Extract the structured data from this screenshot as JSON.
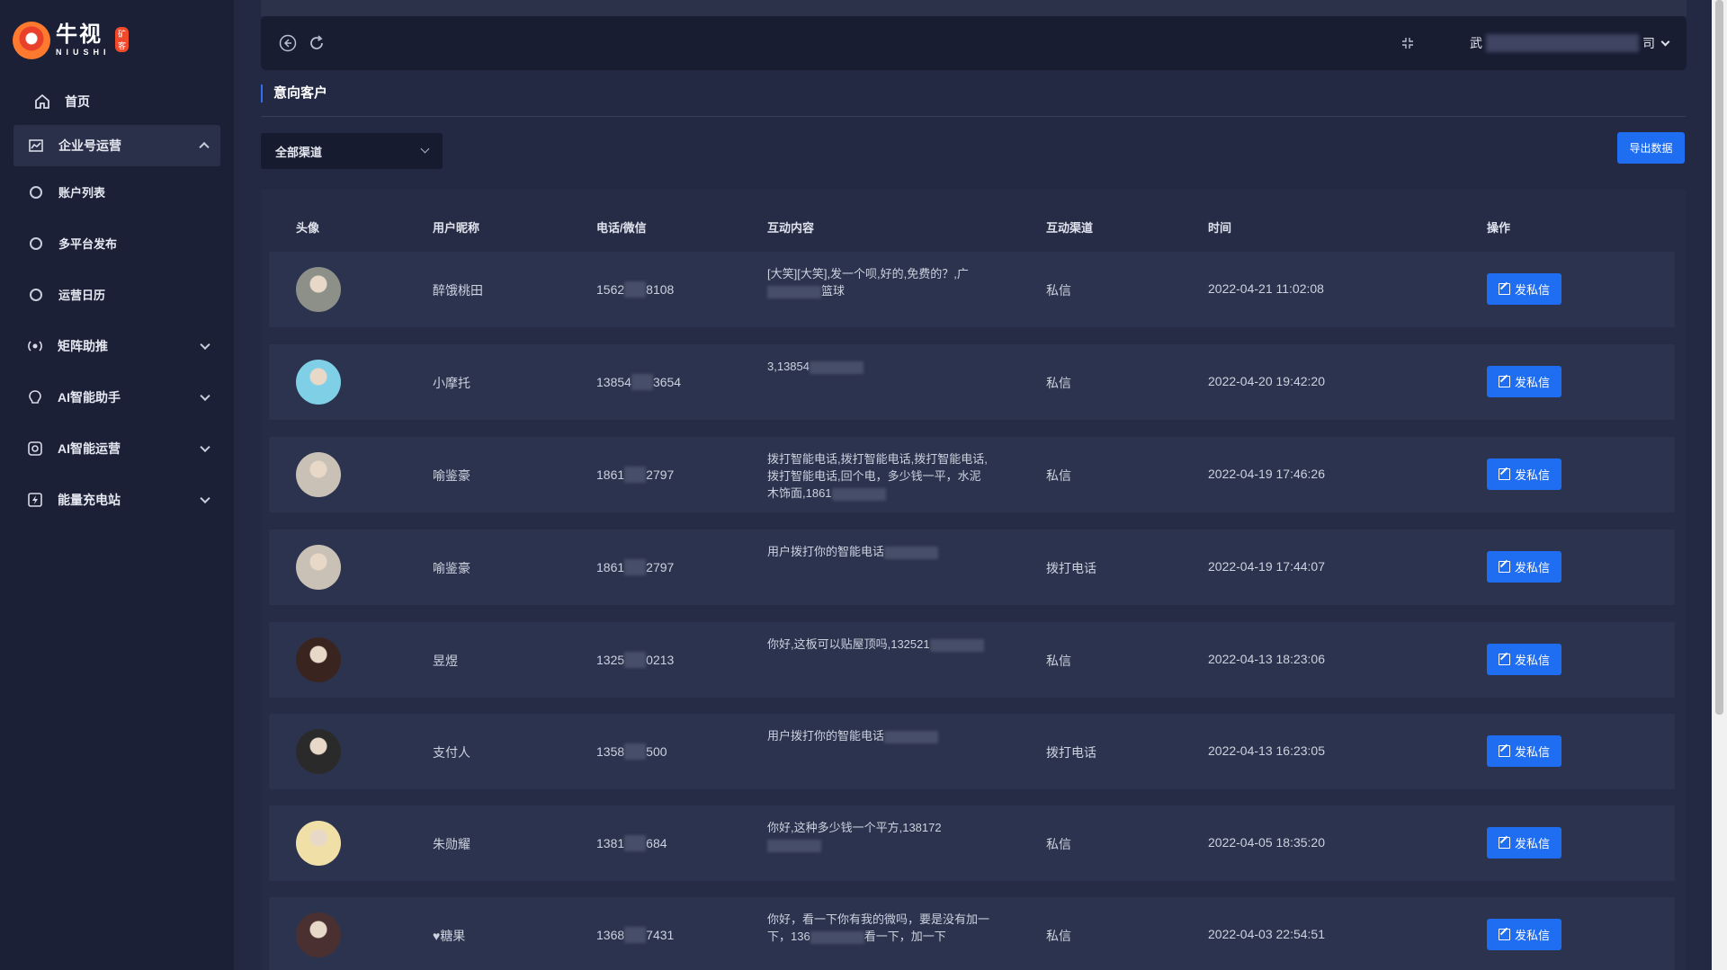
{
  "brand": {
    "name_cn": "牛视",
    "name_en": "NIUSHI",
    "badge": "矿客"
  },
  "sidebar": {
    "home": "首页",
    "group": {
      "label": "企业号运营",
      "items": [
        {
          "label": "账户列表"
        },
        {
          "label": "多平台发布"
        },
        {
          "label": "运营日历"
        }
      ]
    },
    "items": [
      {
        "label": "矩阵助推"
      },
      {
        "label": "AI智能助手"
      },
      {
        "label": "AI智能运营"
      },
      {
        "label": "能量充电站"
      }
    ]
  },
  "topbar": {
    "user_prefix": "武",
    "user_suffix": "司"
  },
  "page": {
    "title": "意向客户",
    "filter_selected": "全部渠道",
    "export_label": "导出数据"
  },
  "table": {
    "headers": [
      "头像",
      "用户昵称",
      "电话/微信",
      "互动内容",
      "互动渠道",
      "时间",
      "操作"
    ],
    "action_label": "发私信",
    "rows": [
      {
        "nickname": "醉饿桃田",
        "phone_a": "1562",
        "phone_b": "8108",
        "content": "[大笑][大笑],发一个呗,好的,免费的？,广",
        "content2": "篮球",
        "channel": "私信",
        "time": "2022-04-21 11:02:08",
        "avatar_color": "#8c9088"
      },
      {
        "nickname": "小摩托",
        "phone_a": "13854",
        "phone_b": "3654",
        "content": "3,13854",
        "content2": "",
        "channel": "私信",
        "time": "2022-04-20 19:42:20",
        "avatar_color": "#7fd0e6"
      },
      {
        "nickname": "喻鉴豪",
        "phone_a": "1861",
        "phone_b": "2797",
        "content": "拨打智能电话,拨打智能电话,拨打智能电话,拨打智能电话,回个电，多少钱一平，水泥木饰面,1861",
        "content2": "",
        "channel": "私信",
        "time": "2022-04-19 17:46:26",
        "avatar_color": "#c9c1b6"
      },
      {
        "nickname": "喻鉴豪",
        "phone_a": "1861",
        "phone_b": "2797",
        "content": "用户拨打你的智能电话",
        "content2": "",
        "channel": "拨打电话",
        "time": "2022-04-19 17:44:07",
        "avatar_color": "#c9c1b6"
      },
      {
        "nickname": "昱煜",
        "phone_a": "1325",
        "phone_b": "0213",
        "content": "你好,这板可以贴屋顶吗,132521",
        "content2": "",
        "channel": "私信",
        "time": "2022-04-13 18:23:06",
        "avatar_color": "#3a2420"
      },
      {
        "nickname": "支付人",
        "phone_a": "1358",
        "phone_b": "500",
        "content": "用户拨打你的智能电话",
        "content2": "",
        "channel": "拨打电话",
        "time": "2022-04-13 16:23:05",
        "avatar_color": "#2a2a2a"
      },
      {
        "nickname": "朱勋耀",
        "phone_a": "1381",
        "phone_b": "684",
        "content": "你好,这种多少钱一个平方,138172",
        "content2": "",
        "channel": "私信",
        "time": "2022-04-05 18:35:20",
        "avatar_color": "#f0e0a8"
      },
      {
        "nickname": "♥糖果",
        "phone_a": "1368",
        "phone_b": "7431",
        "content": "你好，看一下你有我的微吗，要是没有加一下，136",
        "content2": "看一下，加一下",
        "channel": "私信",
        "time": "2022-04-03 22:54:51",
        "avatar_color": "#4a3030"
      }
    ]
  }
}
